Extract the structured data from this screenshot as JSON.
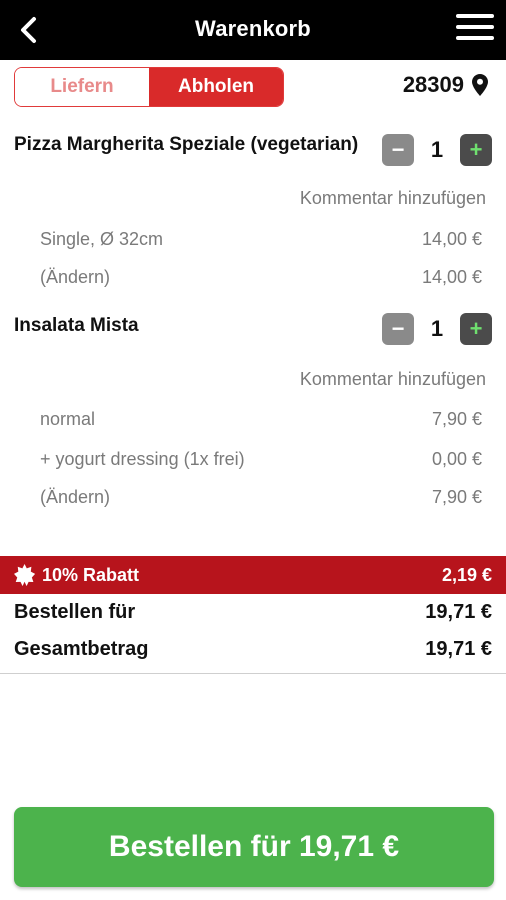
{
  "header": {
    "title": "Warenkorb",
    "back_icon": "chevron-left-icon",
    "menu_icon": "hamburger-menu-icon"
  },
  "delivery_toggle": {
    "options": [
      "Liefern",
      "Abholen"
    ],
    "selected": "Abholen"
  },
  "location": {
    "zip": "28309",
    "icon": "map-pin-icon"
  },
  "cart": {
    "items": [
      {
        "name": "Pizza Margherita Speziale (vegetarian)",
        "quantity": "1",
        "comment_label": "Kommentar hinzufügen",
        "lines": [
          {
            "label": "Single, Ø 32cm",
            "price": "14,00 €"
          },
          {
            "label": "(Ändern)",
            "price": "14,00 €"
          }
        ]
      },
      {
        "name": "Insalata Mista",
        "quantity": "1",
        "comment_label": "Kommentar hinzufügen",
        "lines": [
          {
            "label": "normal",
            "price": "7,90 €"
          },
          {
            "label": "+ yogurt dressing (1x frei)",
            "price": "0,00 €"
          },
          {
            "label": "(Ändern)",
            "price": "7,90 €"
          }
        ]
      }
    ],
    "minus_symbol": "−",
    "plus_symbol": "+"
  },
  "summary": {
    "discount_label": "10% Rabatt",
    "discount_value": "2,19 €",
    "order_for_label": "Bestellen für",
    "order_for_value": "19,71 €",
    "total_label": "Gesamtbetrag",
    "total_value": "19,71 €"
  },
  "order_button": {
    "label": "Bestellen für 19,71 €"
  },
  "colors": {
    "header_bg": "#000000",
    "accent_red": "#d92a2a",
    "discount_bg": "#b7141c",
    "order_green": "#4cb34c"
  }
}
